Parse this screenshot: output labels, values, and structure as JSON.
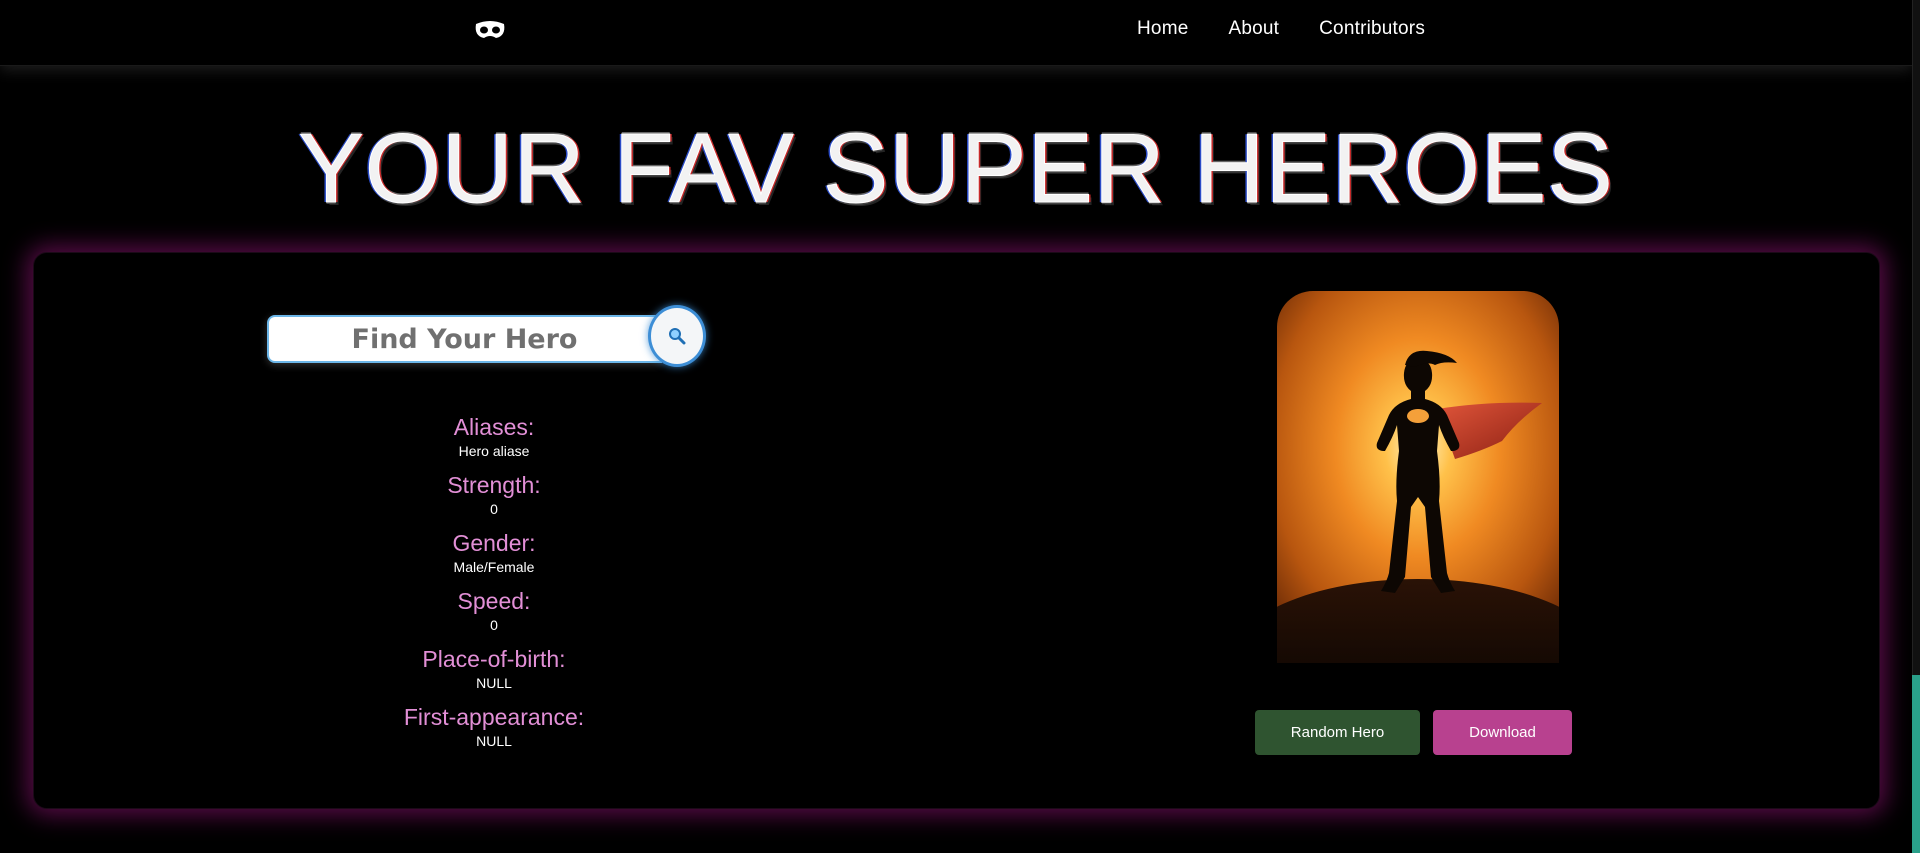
{
  "navbar": {
    "logo_icon": "mask-icon",
    "links": [
      {
        "label": "Home"
      },
      {
        "label": "About"
      },
      {
        "label": "Contributors"
      }
    ]
  },
  "page": {
    "title": "YOUR FAV SUPER HEROES"
  },
  "search": {
    "placeholder": "Find Your Hero",
    "value": "",
    "button_icon": "search-icon"
  },
  "hero_info": [
    {
      "label": "Aliases:",
      "value": "Hero aliase"
    },
    {
      "label": "Strength:",
      "value": "0"
    },
    {
      "label": "Gender:",
      "value": "Male/Female"
    },
    {
      "label": "Speed:",
      "value": "0"
    },
    {
      "label": "Place-of-birth:",
      "value": "NULL"
    },
    {
      "label": "First-appearance:",
      "value": "NULL"
    }
  ],
  "hero_image": {
    "icon": "superhero-silhouette-icon"
  },
  "actions": {
    "random_label": "Random Hero",
    "download_label": "Download"
  },
  "colors": {
    "accent_pink": "#e28fd6",
    "card_glow": "#a01482",
    "random_button": "#2f5430",
    "download_button": "#b8418f",
    "search_border": "#3d8ed6"
  }
}
